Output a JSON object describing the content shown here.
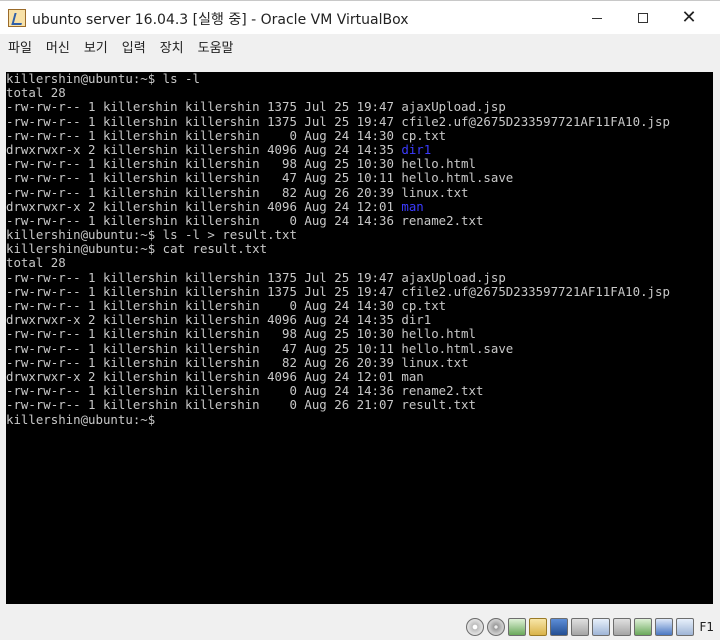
{
  "window": {
    "title": "ubunto server 16.04.3 [실행 중] - Oracle VM VirtualBox",
    "controls": {
      "minimize": "—",
      "maximize": "☐",
      "close": "✕"
    }
  },
  "menu": {
    "items": [
      "파일",
      "머신",
      "보기",
      "입력",
      "장치",
      "도움말"
    ]
  },
  "console": {
    "default_color": "#c8c8c8",
    "highlight_color": "#3b3bff",
    "lines": [
      [
        {
          "t": "killershin@ubuntu:~$ ls -l"
        }
      ],
      [
        {
          "t": "total 28"
        }
      ],
      [
        {
          "t": "-rw-rw-r-- 1 killershin killershin 1375 Jul 25 19:47 ajaxUpload.jsp"
        }
      ],
      [
        {
          "t": "-rw-rw-r-- 1 killershin killershin 1375 Jul 25 19:47 cfile2.uf@2675D233597721AF11FA10.jsp"
        }
      ],
      [
        {
          "t": "-rw-rw-r-- 1 killershin killershin    0 Aug 24 14:30 cp.txt"
        }
      ],
      [
        {
          "t": "drwxrwxr-x 2 killershin killershin 4096 Aug 24 14:35 "
        },
        {
          "t": "dir1",
          "c": "blue"
        }
      ],
      [
        {
          "t": "-rw-rw-r-- 1 killershin killershin   98 Aug 25 10:30 hello.html"
        }
      ],
      [
        {
          "t": "-rw-rw-r-- 1 killershin killershin   47 Aug 25 10:11 hello.html.save"
        }
      ],
      [
        {
          "t": "-rw-rw-r-- 1 killershin killershin   82 Aug 26 20:39 linux.txt"
        }
      ],
      [
        {
          "t": "drwxrwxr-x 2 killershin killershin 4096 Aug 24 12:01 "
        },
        {
          "t": "man",
          "c": "blue"
        }
      ],
      [
        {
          "t": "-rw-rw-r-- 1 killershin killershin    0 Aug 24 14:36 rename2.txt"
        }
      ],
      [
        {
          "t": "killershin@ubuntu:~$ ls -l > result.txt"
        }
      ],
      [
        {
          "t": "killershin@ubuntu:~$ cat result.txt"
        }
      ],
      [
        {
          "t": "total 28"
        }
      ],
      [
        {
          "t": "-rw-rw-r-- 1 killershin killershin 1375 Jul 25 19:47 ajaxUpload.jsp"
        }
      ],
      [
        {
          "t": "-rw-rw-r-- 1 killershin killershin 1375 Jul 25 19:47 cfile2.uf@2675D233597721AF11FA10.jsp"
        }
      ],
      [
        {
          "t": "-rw-rw-r-- 1 killershin killershin    0 Aug 24 14:30 cp.txt"
        }
      ],
      [
        {
          "t": "drwxrwxr-x 2 killershin killershin 4096 Aug 24 14:35 dir1"
        }
      ],
      [
        {
          "t": "-rw-rw-r-- 1 killershin killershin   98 Aug 25 10:30 hello.html"
        }
      ],
      [
        {
          "t": "-rw-rw-r-- 1 killershin killershin   47 Aug 25 10:11 hello.html.save"
        }
      ],
      [
        {
          "t": "-rw-rw-r-- 1 killershin killershin   82 Aug 26 20:39 linux.txt"
        }
      ],
      [
        {
          "t": "drwxrwxr-x 2 killershin killershin 4096 Aug 24 12:01 man"
        }
      ],
      [
        {
          "t": "-rw-rw-r-- 1 killershin killershin    0 Aug 24 14:36 rename2.txt"
        }
      ],
      [
        {
          "t": "-rw-rw-r-- 1 killershin killershin    0 Aug 26 21:07 result.txt"
        }
      ],
      [
        {
          "t": "killershin@ubuntu:~$ "
        }
      ]
    ]
  },
  "statusbar": {
    "icons": [
      "hard-disk-icon",
      "optical-drive-icon",
      "usb-icon",
      "shared-folder-icon",
      "display-icon",
      "network-icon",
      "recording-icon",
      "clipboard-icon",
      "mouse-integration-icon",
      "host-key-arrow-icon",
      "keyboard-icon"
    ],
    "host_key_label": "F1"
  }
}
